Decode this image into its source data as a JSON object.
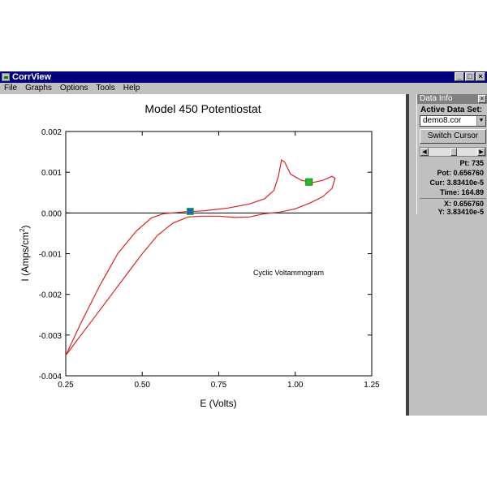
{
  "window": {
    "title": "CorrView",
    "min_symbol": "_",
    "max_symbol": "□",
    "close_symbol": "×"
  },
  "menu": {
    "file": "File",
    "graphs": "Graphs",
    "options": "Options",
    "tools": "Tools",
    "help": "Help"
  },
  "panel": {
    "title": "Data Info",
    "close_symbol": "×",
    "active_label": "Active Data Set:",
    "active_value": "demo8.cor",
    "switch_label": "Switch Cursor",
    "pt": "Pt: 735",
    "pot": "Pot: 0.656760",
    "cur": "Cur: 3.83410e-5",
    "time": "Time: 164.89",
    "x": "X: 0.656760",
    "y": "Y: 3.83410e-5"
  },
  "chart_data": {
    "type": "line",
    "title": "Model 450 Potentiostat",
    "xlabel": "E (Volts)",
    "ylabel": "I (Amps/cm²)",
    "annotation": "Cyclic Voltammogram",
    "xlim": [
      0.25,
      1.25
    ],
    "ylim": [
      -0.004,
      0.002
    ],
    "xticks": [
      0.25,
      0.5,
      0.75,
      1.0,
      1.25
    ],
    "xtick_labels": [
      "0.25",
      "0.50",
      "0.75",
      "1.00",
      "1.25"
    ],
    "yticks": [
      0.002,
      0.001,
      0.0,
      -0.001,
      -0.002,
      -0.003,
      -0.004
    ],
    "ytick_labels": [
      "0.002",
      "0.001",
      "0.000",
      "-0.001",
      "-0.002",
      "-0.003",
      "-0.004"
    ],
    "series_color": "#e02020",
    "series": [
      {
        "x": [
          0.25,
          0.3,
          0.36,
          0.42,
          0.48,
          0.53,
          0.57,
          0.6,
          0.64,
          0.7,
          0.78,
          0.85,
          0.9,
          0.93,
          0.945,
          0.955,
          0.965,
          0.985,
          1.02,
          1.06,
          1.09,
          1.12,
          1.13,
          1.12,
          1.09,
          1.05,
          1.0,
          0.95,
          0.9,
          0.85,
          0.8,
          0.75,
          0.7,
          0.65,
          0.6,
          0.55,
          0.5,
          0.45,
          0.4,
          0.35,
          0.3,
          0.25
        ],
        "y": [
          -0.0035,
          -0.0027,
          -0.0018,
          -0.001,
          -0.00045,
          -0.00012,
          -2e-05,
          0.0,
          3e-05,
          5e-05,
          0.00012,
          0.00022,
          0.00035,
          0.00055,
          0.0009,
          0.0013,
          0.00125,
          0.00095,
          0.0008,
          0.00075,
          0.0008,
          0.0009,
          0.00085,
          0.0006,
          0.0004,
          0.00025,
          0.0001,
          2e-05,
          -2e-05,
          -0.0001,
          -0.00011,
          -8e-05,
          -8e-05,
          -0.0001,
          -0.00025,
          -0.00055,
          -0.001,
          -0.0015,
          -0.002,
          -0.0025,
          -0.003,
          -0.0035
        ]
      }
    ],
    "cursors": [
      {
        "x": 0.65676,
        "y": 3.8341e-05,
        "color": "#2060c0"
      },
      {
        "x": 1.045,
        "y": 0.00076,
        "color": "#20c020"
      }
    ]
  }
}
